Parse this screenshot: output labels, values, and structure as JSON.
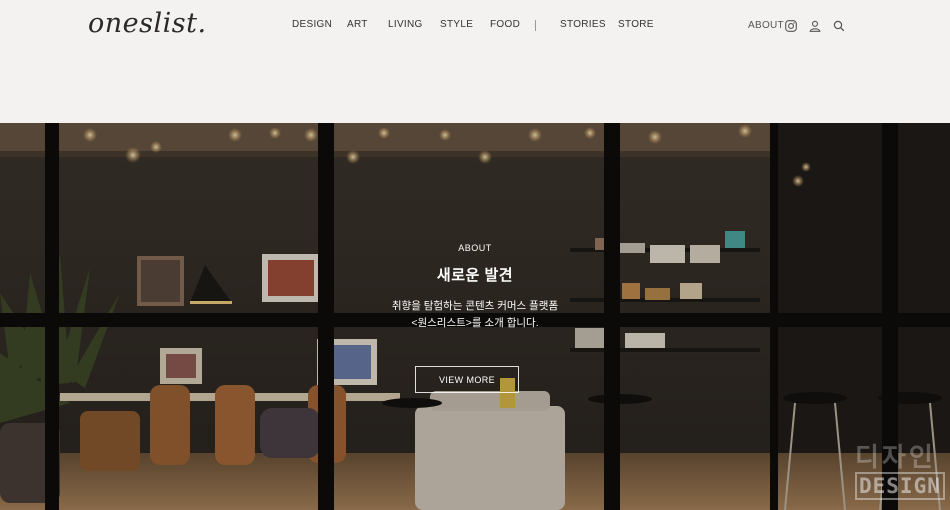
{
  "header": {
    "logo": "oneslist.",
    "nav": [
      {
        "label": "DESIGN"
      },
      {
        "label": "ART"
      },
      {
        "label": "LIVING"
      },
      {
        "label": "STYLE"
      },
      {
        "label": "FOOD"
      },
      {
        "label": "STORIES"
      },
      {
        "label": "STORE"
      }
    ],
    "utility": {
      "about_label": "ABOUT",
      "icons": [
        "instagram-icon",
        "user-icon",
        "search-icon"
      ]
    }
  },
  "hero": {
    "eyebrow": "ABOUT",
    "title": "새로운 발견",
    "description_line1": "취향을 탐험하는 콘텐츠 커머스 플랫폼",
    "description_line2": "<원스리스트>를 소개 합니다.",
    "button_label": "VIEW MORE"
  },
  "watermark": {
    "korean": "디자인",
    "english": "DESIGN"
  },
  "colors": {
    "header_bg": "#f3f2f0",
    "text_dark": "#333333",
    "hero_overlay_text": "#ffffff"
  }
}
